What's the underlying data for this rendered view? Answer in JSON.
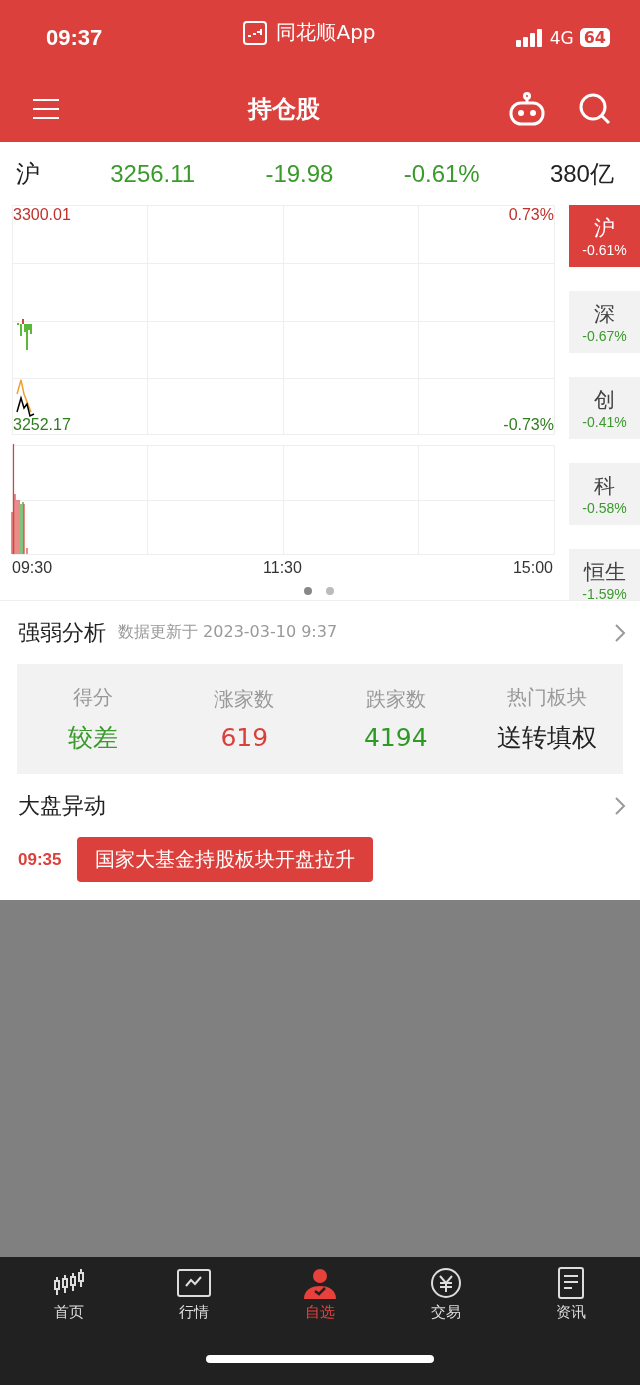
{
  "status_bar": {
    "time": "09:37",
    "app": "同花顺App",
    "network": "4G",
    "battery": "64"
  },
  "nav": {
    "title": "持仓股"
  },
  "quote": {
    "index": "沪",
    "price": "3256.11",
    "change": "-19.98",
    "percent": "-0.61%",
    "volume": "380亿"
  },
  "chart": {
    "top_price": "3300.01",
    "top_percent": "0.73%",
    "bottom_price": "3252.17",
    "bottom_percent": "-0.73%",
    "times": [
      "09:30",
      "11:30",
      "15:00"
    ]
  },
  "pager": [
    {
      "selected": true
    },
    {
      "selected": false
    }
  ],
  "index_tabs": [
    {
      "name": "沪",
      "percent": "-0.61%",
      "selected": true
    },
    {
      "name": "深",
      "percent": "-0.67%",
      "selected": false
    },
    {
      "name": "创",
      "percent": "-0.41%",
      "selected": false
    },
    {
      "name": "科",
      "percent": "-0.58%",
      "selected": false
    },
    {
      "name": "恒生",
      "percent": "-1.59%",
      "selected": false
    }
  ],
  "analysis": {
    "title": "强弱分析",
    "updated": "数据更新于 2023-03-10 9:37",
    "stats": [
      {
        "label": "得分",
        "value": "较差",
        "color": "#3a9a2c"
      },
      {
        "label": "涨家数",
        "value": "619",
        "color": "#d8403a"
      },
      {
        "label": "跌家数",
        "value": "4194",
        "color": "#2e9a25"
      },
      {
        "label": "热门板块",
        "value": "送转填权",
        "color": "#222222"
      }
    ]
  },
  "movement": {
    "title": "大盘异动",
    "events": [
      {
        "time": "09:35",
        "text": "国家大基金持股板块开盘拉升"
      }
    ]
  },
  "tab_bar": [
    {
      "kind": "candles",
      "label": "首页",
      "selected": false
    },
    {
      "kind": "chart",
      "label": "行情",
      "selected": false
    },
    {
      "kind": "person",
      "label": "自选",
      "selected": true
    },
    {
      "kind": "yuan",
      "label": "交易",
      "selected": false
    },
    {
      "kind": "doc",
      "label": "资讯",
      "selected": false
    }
  ]
}
